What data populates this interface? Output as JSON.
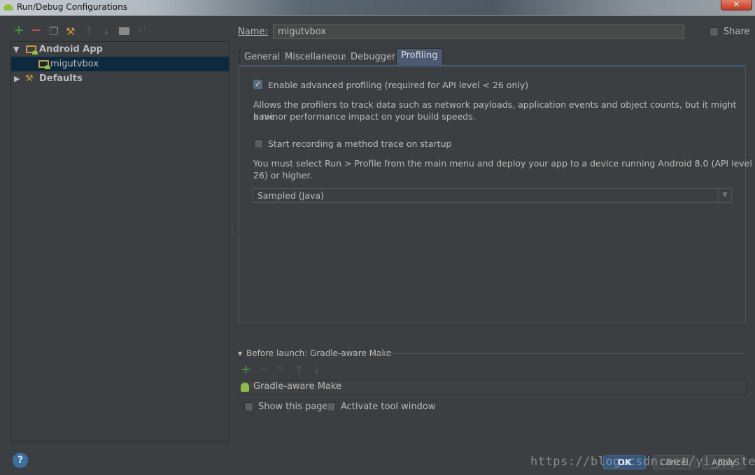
{
  "window": {
    "title": "Run/Debug Configurations",
    "close_glyph": "✕"
  },
  "toolbar": {
    "icons": [
      "add-icon",
      "remove-icon",
      "copy-icon",
      "wrench-icon",
      "move-up-icon",
      "move-down-icon",
      "folder-icon",
      "sort-icon"
    ]
  },
  "tree": {
    "items": [
      {
        "label": "Android App",
        "expanded": true
      },
      {
        "label": "migutvbox",
        "selected": true
      },
      {
        "label": "Defaults",
        "expanded": false
      }
    ]
  },
  "name_field": {
    "label": "Name:",
    "value": "migutvbox"
  },
  "share": {
    "label": "Share",
    "checked": false
  },
  "tabs": [
    {
      "label": "General"
    },
    {
      "label": "Miscellaneous"
    },
    {
      "label": "Debugger"
    },
    {
      "label": "Profiling",
      "active": true
    }
  ],
  "profiling": {
    "enable_advanced": {
      "label": "Enable advanced profiling (required for API level < 26 only)",
      "checked": true
    },
    "enable_desc_1": "Allows the profilers to track data such as network payloads, application events and object counts, but it might have",
    "enable_desc_2": "a minor performance impact on your build speeds.",
    "start_recording": {
      "label": "Start recording a method trace on startup",
      "checked": false
    },
    "recording_desc_1": "You must select Run > Profile from the main menu and deploy your app to a device running Android 8.0 (API level",
    "recording_desc_2": "26) or higher.",
    "trace_type": "Sampled (Java)"
  },
  "before_launch": {
    "label": "Before launch: Gradle-aware Make",
    "tasks": [
      "Gradle-aware Make"
    ]
  },
  "show_page": {
    "label": "Show this page",
    "checked": false
  },
  "activate_tool": {
    "label": "Activate tool window",
    "checked": false
  },
  "buttons": {
    "ok": "OK",
    "cancel": "Cancel",
    "apply": "Apply",
    "help": "?"
  },
  "watermark": "https://blog.csdn.net/yi_master",
  "colors": {
    "accent": "#4a5a72",
    "background": "#3c3f41",
    "selection": "#0d293e",
    "add_green": "#3f9f3f",
    "remove_red": "#c75450"
  }
}
